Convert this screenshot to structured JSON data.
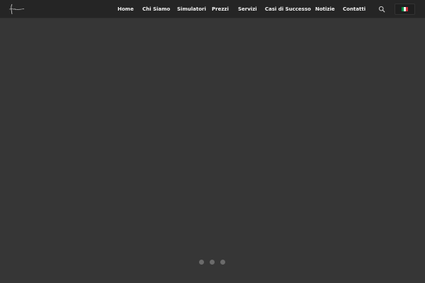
{
  "header": {
    "logo_icon": "calligraphy-logo",
    "nav": [
      {
        "label": "Home"
      },
      {
        "label": "Chi Siamo"
      },
      {
        "label": "Simulatori"
      },
      {
        "label": "Prezzi"
      },
      {
        "label": "Servizi"
      },
      {
        "label": "Casi di Successo"
      },
      {
        "label": "Notizie"
      },
      {
        "label": "Contatti"
      }
    ],
    "search_icon": "search-icon",
    "language": {
      "icon": "italian-flag-icon",
      "flag_colors": [
        "#009246",
        "#ffffff",
        "#ce2b37"
      ]
    }
  },
  "slider": {
    "slide_count": 3,
    "active_index": 0,
    "background": "#363636",
    "dot_color": "#6b6b6b"
  },
  "colors": {
    "header_bg": "#252525",
    "page_bg": "#363636",
    "nav_text": "#f2f2f2"
  }
}
